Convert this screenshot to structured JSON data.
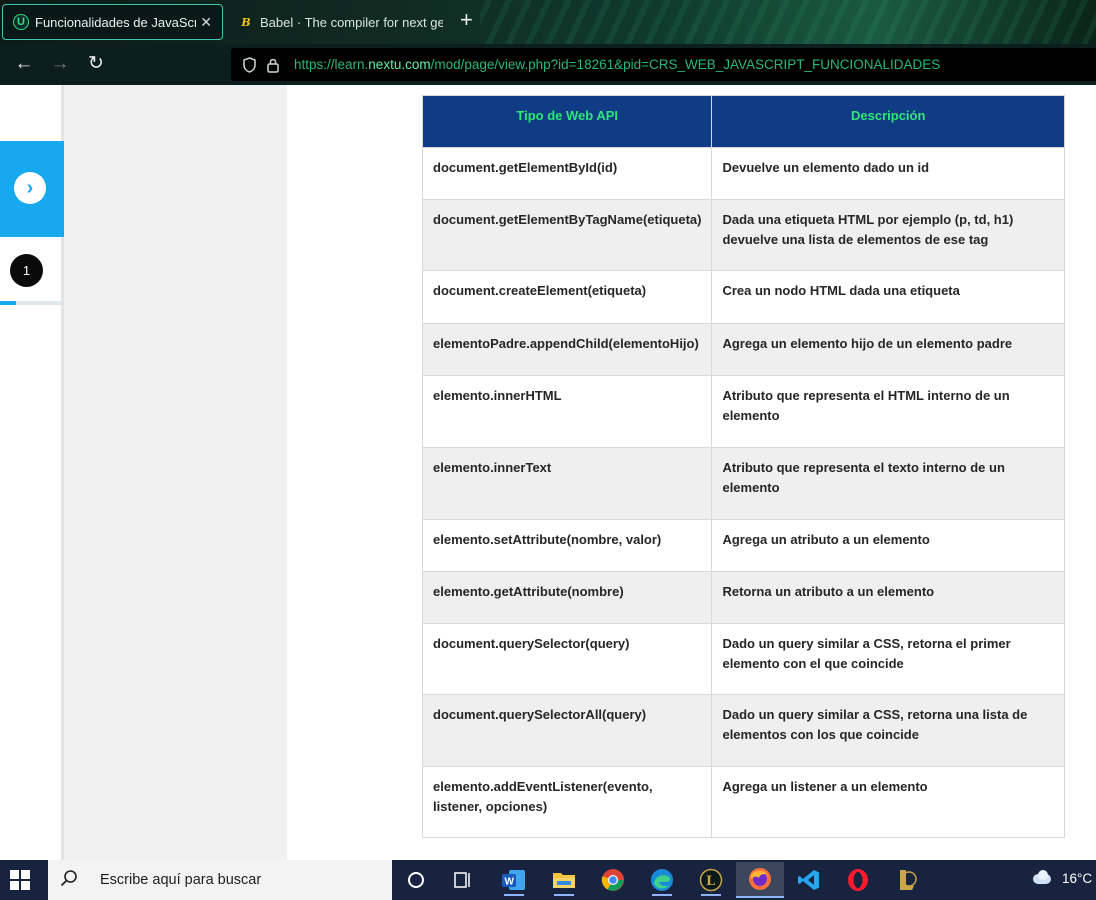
{
  "browser": {
    "tabs": [
      {
        "title": "Funcionalidades de JavaScript: N",
        "favicon": "U"
      },
      {
        "title": "Babel · The compiler for next ge",
        "favicon": "B"
      }
    ],
    "new_tab": "+",
    "close": "✕",
    "url_prefix": "https://learn.",
    "url_domain": "nextu.com",
    "url_path": "/mod/page/view.php?id=18261&pid=CRS_WEB_JAVASCRIPT_FUNCIONALIDADES",
    "nav": {
      "back": "←",
      "forward": "→",
      "reload": "↻"
    }
  },
  "sidebar": {
    "next_icon": "›",
    "page_number": "1",
    "progress": 0.26,
    "accent_color": "#18a8f0"
  },
  "table": {
    "headers": [
      "Tipo de Web API",
      "Descripción"
    ],
    "rows": [
      [
        "document.getElementById(id)",
        "Devuelve un elemento dado un id"
      ],
      [
        "document.getElementByTagName(etiqueta)",
        "Dada una etiqueta HTML por ejemplo (p, td, h1) devuelve una lista de elementos de ese tag"
      ],
      [
        "document.createElement(etiqueta)",
        "Crea un nodo HTML dada una etiqueta"
      ],
      [
        "elementoPadre.appendChild(elementoHijo)",
        "Agrega un elemento hijo de un elemento padre"
      ],
      [
        "elemento.innerHTML",
        "Atributo que representa el HTML interno de un elemento"
      ],
      [
        "elemento.innerText",
        "Atributo que representa el texto interno de un elemento"
      ],
      [
        "elemento.setAttribute(nombre, valor)",
        "Agrega un atributo a un elemento"
      ],
      [
        "elemento.getAttribute(nombre)",
        "Retorna un atributo a un elemento"
      ],
      [
        "document.querySelector(query)",
        "Dado un query similar a CSS, retorna el primer elemento con el que coincide"
      ],
      [
        "document.querySelectorAll(query)",
        "Dado un query similar a CSS, retorna una lista de elementos con los que coincide"
      ],
      [
        "elemento.addEventListener(evento, listener, opciones)",
        "Agrega un listener a un elemento"
      ]
    ],
    "header_bg": "#103c86",
    "header_text_color": "#2ee676"
  },
  "taskbar": {
    "search_placeholder": "Escribe aquí para buscar",
    "weather_temp": "16°C",
    "apps": [
      "cortana-icon",
      "task-view-icon",
      "word-icon",
      "file-explorer-icon",
      "chrome-icon",
      "edge-icon",
      "league-of-legends-icon",
      "firefox-icon",
      "vscode-icon",
      "opera-icon",
      "league-of-legends-client-icon"
    ]
  }
}
